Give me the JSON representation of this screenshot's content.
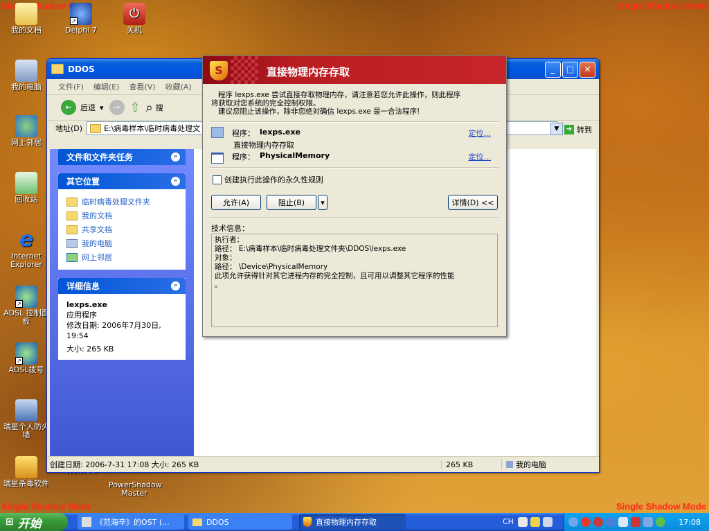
{
  "watermark": "Single Shadow Mode",
  "desktop_icons": [
    {
      "label": "我的文档"
    },
    {
      "label": "Delphi 7"
    },
    {
      "label": "关机"
    },
    {
      "label": "我的电脑"
    },
    {
      "label": "网上邻居"
    },
    {
      "label": "回收站"
    },
    {
      "label": "Internet Explorer"
    },
    {
      "label": "ADSL 控制面板"
    },
    {
      "label": "ADSL拨号"
    },
    {
      "label": "瑞星个人防火墙"
    },
    {
      "label": "瑞星杀毒软件"
    },
    {
      "label": "WinMD5"
    },
    {
      "label": "PowerShadow Master"
    }
  ],
  "explorer": {
    "title": "DDOS",
    "menu": [
      "文件(F)",
      "编辑(E)",
      "查看(V)",
      "收藏(A)"
    ],
    "back_label": "后退",
    "search_label": "搜",
    "address_label": "地址(D)",
    "address_value": "E:\\病毒样本\\临时病毒处理文",
    "go_label": "转到",
    "tasks_header": "文件和文件夹任务",
    "places_header": "其它位置",
    "places": [
      "临时病毒处理文件夹",
      "我的文档",
      "共享文档",
      "我的电脑",
      "网上邻居"
    ],
    "details_header": "详细信息",
    "details": {
      "name": "lexps.exe",
      "type": "应用程序",
      "modified": "修改日期: 2006年7月30日, 19:54",
      "size": "大小: 265 KB"
    },
    "status": {
      "left": "创建日期: 2006-7-31 17:08 大小: 265 KB",
      "size": "265 KB",
      "location": "我的电脑"
    }
  },
  "dialog": {
    "title": "直接物理内存存取",
    "desc_line1": "程序 lexps.exe 尝试直接存取物理内存，请注意若您允许此操作，则此程序",
    "desc_line2": "将获取对您系统的完全控制权限。",
    "desc_line3": "建议您阻止该操作，除非您绝对确信  lexps.exe 是一合法程序!",
    "program_label": "程序：",
    "program1": "lexps.exe",
    "program1_action": "直接物理内存存取",
    "program2": "PhysicalMemory",
    "locate": "定位...",
    "checkbox_label": "创建执行此操作的永久性规则",
    "allow": "允许(A)",
    "block": "阻止(B)",
    "details": "详情(D) <<",
    "tech_label": "技术信息：",
    "tech_lines": [
      "执行者：",
      "   路径： E:\\病毒样本\\临时病毒处理文件夹\\DDOS\\lexps.exe",
      "对象：",
      "   路径： \\Device\\PhysicalMemory",
      "此项允许获得针对其它进程内存的完全控制，且可用以调整其它程序的性能",
      "。"
    ]
  },
  "taskbar": {
    "start": "开始",
    "tasks": [
      "《范海辛》的OST (...",
      "DDOS",
      "直接物理内存存取"
    ],
    "lang": "CH",
    "clock": "17:08"
  }
}
